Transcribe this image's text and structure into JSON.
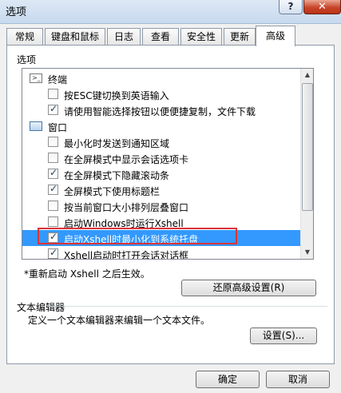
{
  "window": {
    "title": "选项",
    "help_label": "?",
    "close_label": "✕"
  },
  "tabs": [
    {
      "label": "常规"
    },
    {
      "label": "键盘和鼠标"
    },
    {
      "label": "日志"
    },
    {
      "label": "查看"
    },
    {
      "label": "安全性"
    },
    {
      "label": "更新"
    },
    {
      "label": "高级"
    }
  ],
  "options_group": {
    "label": "选项"
  },
  "tree": [
    {
      "type": "category",
      "icon": "terminal-icon",
      "label": "终端"
    },
    {
      "type": "option",
      "label": "按ESC键切换到英语输入",
      "checked": false
    },
    {
      "type": "option",
      "label": "请使用智能选择按钮以便便捷复制，文件下载",
      "checked": true
    },
    {
      "type": "category",
      "icon": "window-icon",
      "label": "窗口"
    },
    {
      "type": "option",
      "label": "最小化时发送到通知区域",
      "checked": false
    },
    {
      "type": "option",
      "label": "在全屏模式中显示会话选项卡",
      "checked": false
    },
    {
      "type": "option",
      "label": "在全屏模式下隐藏滚动条",
      "checked": true
    },
    {
      "type": "option",
      "label": "全屏模式下使用标题栏",
      "checked": true
    },
    {
      "type": "option",
      "label": "按当前窗口大小排列层叠窗口",
      "checked": false
    },
    {
      "type": "option",
      "label": "启动Windows时运行Xshell",
      "checked": false
    },
    {
      "type": "option",
      "label": "启动Xshell时最小化到系统托盘",
      "checked": true,
      "selected": true
    },
    {
      "type": "option",
      "label": "Xshell启动时打开会话对话框",
      "checked": true
    }
  ],
  "restart_note": "*重新启动 Xshell 之后生效。",
  "restore_button": "还原高级设置(R)",
  "text_editor": {
    "label": "文本编辑器",
    "description": "定义一个文本编辑器来编辑一个文本文件。",
    "settings_button": "设置(S)..."
  },
  "bottom_buttons": {
    "ok": "确定",
    "cancel": "取消"
  },
  "colors": {
    "selection": "#3399ff",
    "highlight_border": "#d9343a"
  }
}
